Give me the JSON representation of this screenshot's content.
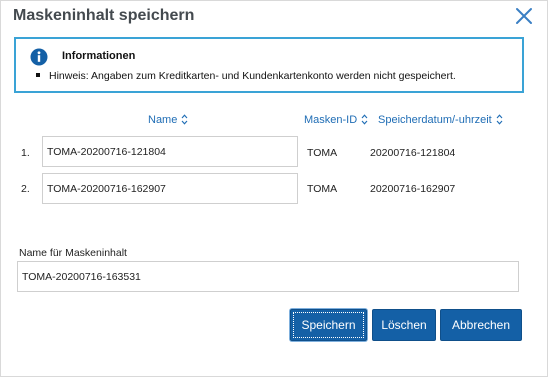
{
  "dialog": {
    "title": "Maskeninhalt speichern",
    "close_icon": "close-icon"
  },
  "info": {
    "icon": "info-icon",
    "heading": "Informationen",
    "notes": [
      "Hinweis: Angaben zum Kreditkarten- und Kundenkartenkonto werden nicht gespeichert."
    ]
  },
  "table": {
    "columns": {
      "name": "Name",
      "mask_id": "Masken-ID",
      "saved_at": "Speicherdatum/-uhrzeit"
    },
    "sort_icon": "sort-icon",
    "rows": [
      {
        "index": "1.",
        "name": "TOMA-20200716-121804",
        "mask_id": "TOMA",
        "saved_at": "20200716-121804"
      },
      {
        "index": "2.",
        "name": "TOMA-20200716-162907",
        "mask_id": "TOMA",
        "saved_at": "20200716-162907"
      }
    ]
  },
  "form": {
    "label": "Name für Maskeninhalt",
    "value": "TOMA-20200716-163531"
  },
  "buttons": {
    "save": "Speichern",
    "delete": "Löschen",
    "cancel": "Abbrechen"
  },
  "colors": {
    "accent": "#1460a6",
    "info_border": "#3aa3d6",
    "link": "#1f6db5"
  }
}
